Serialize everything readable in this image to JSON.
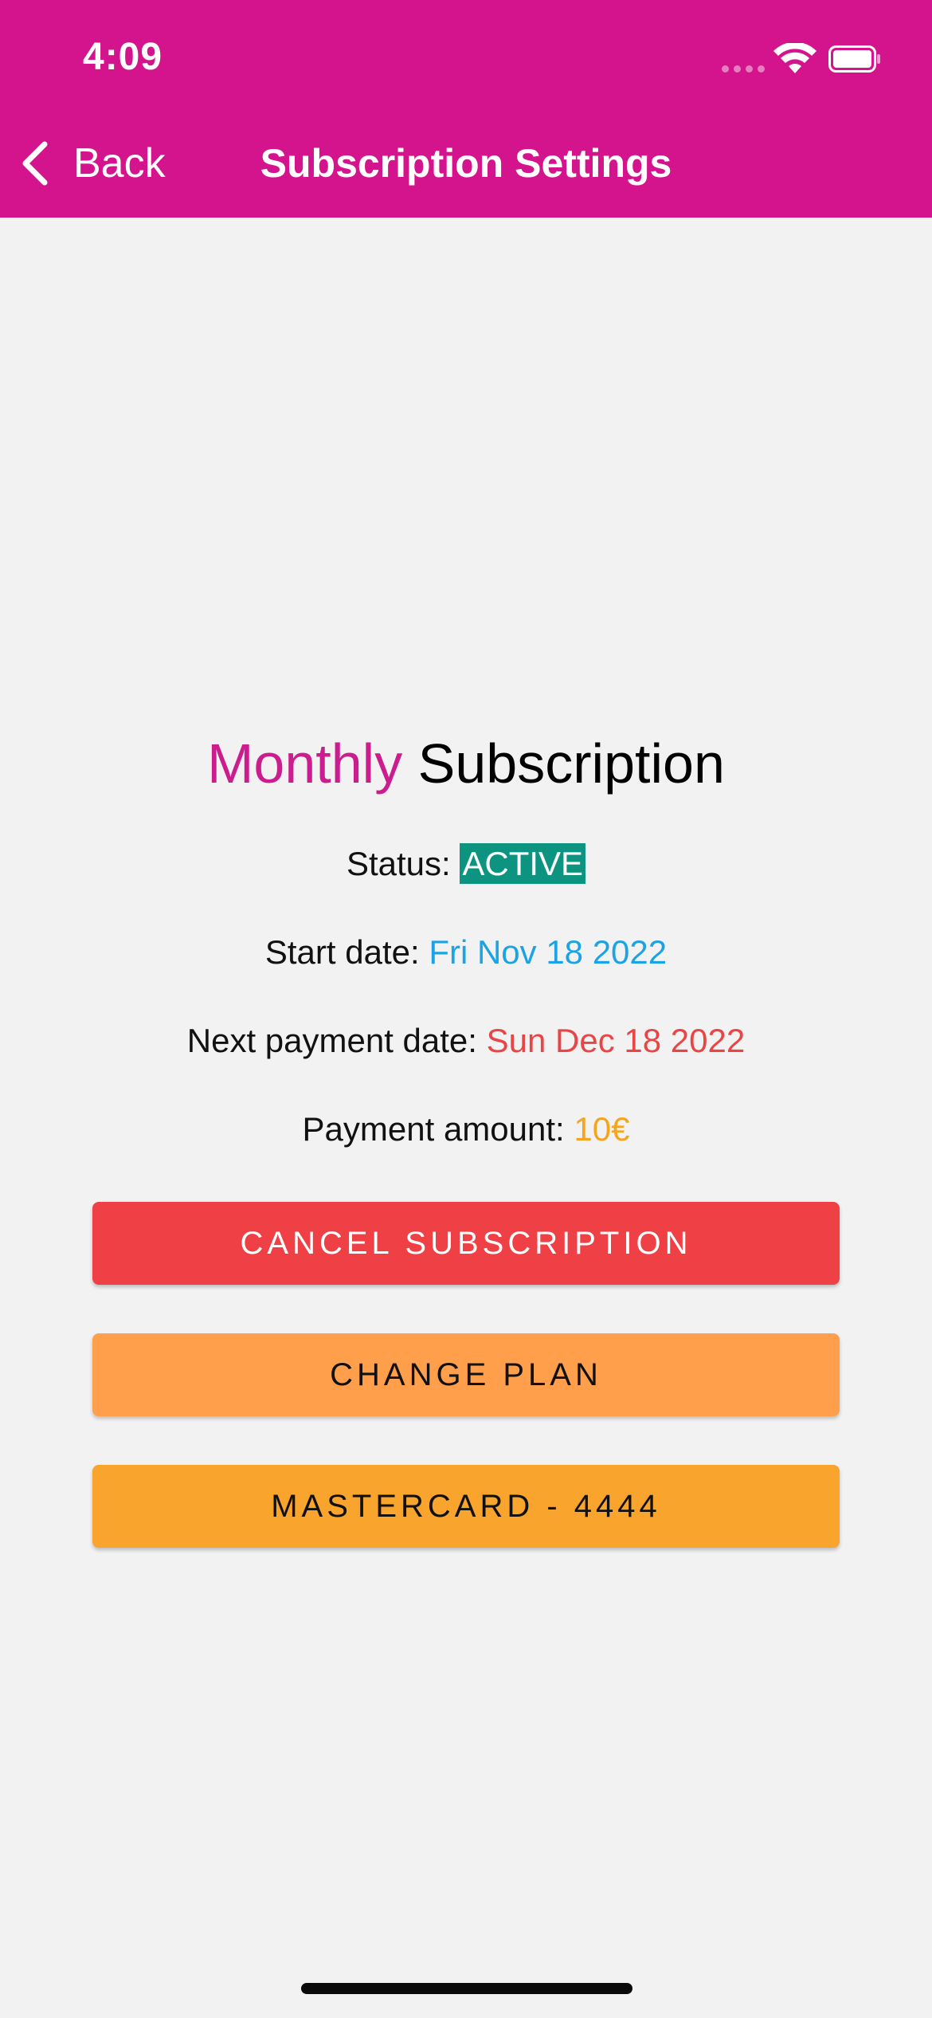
{
  "status_bar": {
    "time": "4:09",
    "icons": [
      "signal-icon",
      "wifi-icon",
      "battery-icon"
    ]
  },
  "nav": {
    "back_label": "Back",
    "back_icon": "chevron-left-icon",
    "title": "Subscription Settings"
  },
  "subscription": {
    "plan": "Monthly",
    "title_suffix": "Subscription",
    "status_label": "Status:",
    "status_value": "ACTIVE",
    "start_label": "Start date:",
    "start_value": "Fri Nov 18 2022",
    "next_label": "Next payment date:",
    "next_value": "Sun Dec 18 2022",
    "amount_label": "Payment amount:",
    "amount_value": "10€"
  },
  "buttons": {
    "cancel": "CANCEL SUBSCRIPTION",
    "change": "CHANGE PLAN",
    "card": "MASTERCARD - 4444"
  },
  "colors": {
    "header": "#d4148c",
    "plan_accent": "#cc1d8e",
    "status_active": "#0c9481",
    "start_date": "#1ba3e6",
    "next_date": "#e84646",
    "amount": "#f6a41f",
    "cancel_button": "#ef4045",
    "change_button": "#ff9f4c",
    "card_button": "#f8a42d",
    "background": "#f2f2f2"
  }
}
